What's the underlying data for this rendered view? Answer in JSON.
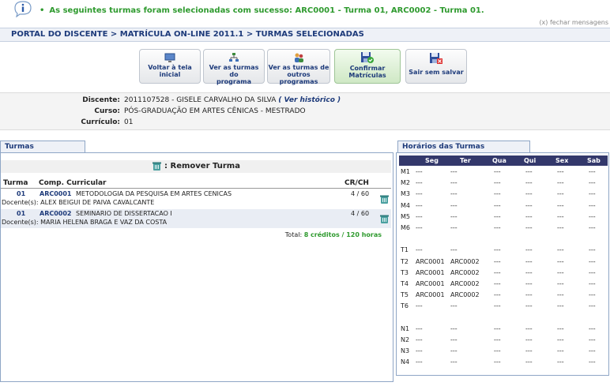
{
  "message": {
    "text": "ARC0001 - Turma 01, ARC0002 - Turma 01.",
    "prefix": "As seguintes turmas foram selecionadas com sucesso: ",
    "close_label": "(x) fechar mensagens"
  },
  "breadcrumb": "PORTAL DO DISCENTE > MATRÍCULA ON-LINE 2011.1 > TURMAS SELECIONADAS",
  "toolbar": {
    "voltar": [
      "Voltar à tela",
      "inicial"
    ],
    "ver_programa": [
      "Ver as turmas do",
      "programa"
    ],
    "ver_outros": [
      "Ver as turmas de",
      "outros programas"
    ],
    "confirmar": [
      "Confirmar",
      "Matrículas"
    ],
    "sair": "Sair sem salvar"
  },
  "discente": {
    "discente_label": "Discente:",
    "discente_value": "2011107528 - GISELE CARVALHO DA SILVA",
    "historico_link": "( Ver histórico )",
    "curso_label": "Curso:",
    "curso_value": "PÓS-GRADUAÇÃO EM ARTES CÊNICAS - MESTRADO",
    "curriculo_label": "Currículo:",
    "curriculo_value": "01"
  },
  "left": {
    "tab": "Turmas Selecionadas",
    "remover": ": Remover Turma",
    "headers": {
      "turma": "Turma",
      "comp": "Comp. Curricular",
      "crch": "CR/CH"
    },
    "rows": [
      {
        "turma": "01",
        "code": "ARC0001",
        "name": "METODOLOGIA DA PESQUISA EM ARTES CENICAS",
        "crch": "4 / 60",
        "docente": "Docente(s): ALEX BEIGUI DE PAIVA CAVALCANTE"
      },
      {
        "turma": "01",
        "code": "ARC0002",
        "name": "SEMINARIO DE DISSERTACAO I",
        "crch": "4 / 60",
        "docente": "Docente(s): MARIA HELENA BRAGA E VAZ DA COSTA"
      }
    ],
    "total_label": "Total:",
    "total_value": "8 créditos / 120 horas"
  },
  "right": {
    "tab": "Horários das Turmas Selecionadas",
    "days": [
      "Seg",
      "Ter",
      "Qua",
      "Qui",
      "Sex",
      "Sab"
    ],
    "rows": [
      {
        "h": "M1",
        "c": [
          "---",
          "---",
          "---",
          "---",
          "---",
          "---"
        ]
      },
      {
        "h": "M2",
        "c": [
          "---",
          "---",
          "---",
          "---",
          "---",
          "---"
        ]
      },
      {
        "h": "M3",
        "c": [
          "---",
          "---",
          "---",
          "---",
          "---",
          "---"
        ]
      },
      {
        "h": "M4",
        "c": [
          "---",
          "---",
          "---",
          "---",
          "---",
          "---"
        ]
      },
      {
        "h": "M5",
        "c": [
          "---",
          "---",
          "---",
          "---",
          "---",
          "---"
        ]
      },
      {
        "h": "M6",
        "c": [
          "---",
          "---",
          "---",
          "---",
          "---",
          "---"
        ]
      },
      {
        "h": "",
        "c": [
          "",
          "",
          "",
          "",
          "",
          ""
        ]
      },
      {
        "h": "T1",
        "c": [
          "---",
          "---",
          "---",
          "---",
          "---",
          "---"
        ]
      },
      {
        "h": "T2",
        "c": [
          "ARC0001",
          "ARC0002",
          "---",
          "---",
          "---",
          "---"
        ]
      },
      {
        "h": "T3",
        "c": [
          "ARC0001",
          "ARC0002",
          "---",
          "---",
          "---",
          "---"
        ]
      },
      {
        "h": "T4",
        "c": [
          "ARC0001",
          "ARC0002",
          "---",
          "---",
          "---",
          "---"
        ]
      },
      {
        "h": "T5",
        "c": [
          "ARC0001",
          "ARC0002",
          "---",
          "---",
          "---",
          "---"
        ]
      },
      {
        "h": "T6",
        "c": [
          "---",
          "---",
          "---",
          "---",
          "---",
          "---"
        ]
      },
      {
        "h": "",
        "c": [
          "",
          "",
          "",
          "",
          "",
          ""
        ]
      },
      {
        "h": "N1",
        "c": [
          "---",
          "---",
          "---",
          "---",
          "---",
          "---"
        ]
      },
      {
        "h": "N2",
        "c": [
          "---",
          "---",
          "---",
          "---",
          "---",
          "---"
        ]
      },
      {
        "h": "N3",
        "c": [
          "---",
          "---",
          "---",
          "---",
          "---",
          "---"
        ]
      },
      {
        "h": "N4",
        "c": [
          "---",
          "---",
          "---",
          "---",
          "---",
          "---"
        ]
      }
    ]
  },
  "colors": {
    "success": "#2e9a2e",
    "link": "#1d3a7a",
    "grid_header": "#33386b",
    "panel_border": "#8fa6c6"
  },
  "icons": [
    "info-icon",
    "monitor-icon",
    "hierarchy-icon",
    "people-icon",
    "save-check-icon",
    "save-cancel-icon",
    "trash-icon"
  ]
}
